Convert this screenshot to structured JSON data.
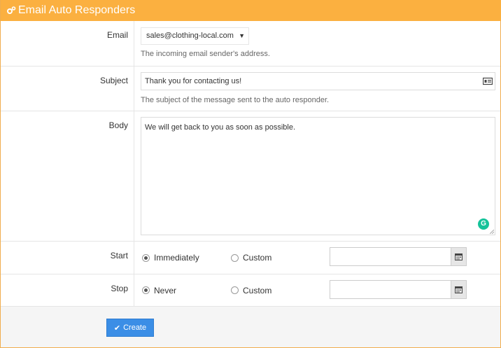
{
  "header": {
    "title": "Email Auto Responders",
    "icon": "gears-icon"
  },
  "email": {
    "label": "Email",
    "value": "sales@clothing-local.com",
    "help": "The incoming email sender's address."
  },
  "subject": {
    "label": "Subject",
    "value": "Thank you for contacting us!",
    "help": "The subject of the message sent to the auto responder."
  },
  "body": {
    "label": "Body",
    "value": "We will get back to you as soon as possible."
  },
  "start": {
    "label": "Start",
    "option_a": "Immediately",
    "option_b": "Custom",
    "selected": "Immediately",
    "date_value": ""
  },
  "stop": {
    "label": "Stop",
    "option_a": "Never",
    "option_b": "Custom",
    "selected": "Never",
    "date_value": ""
  },
  "footer": {
    "create_label": "Create"
  },
  "colors": {
    "header": "#fbb040",
    "button": "#3b8ee6",
    "grammarly": "#15c39a"
  }
}
